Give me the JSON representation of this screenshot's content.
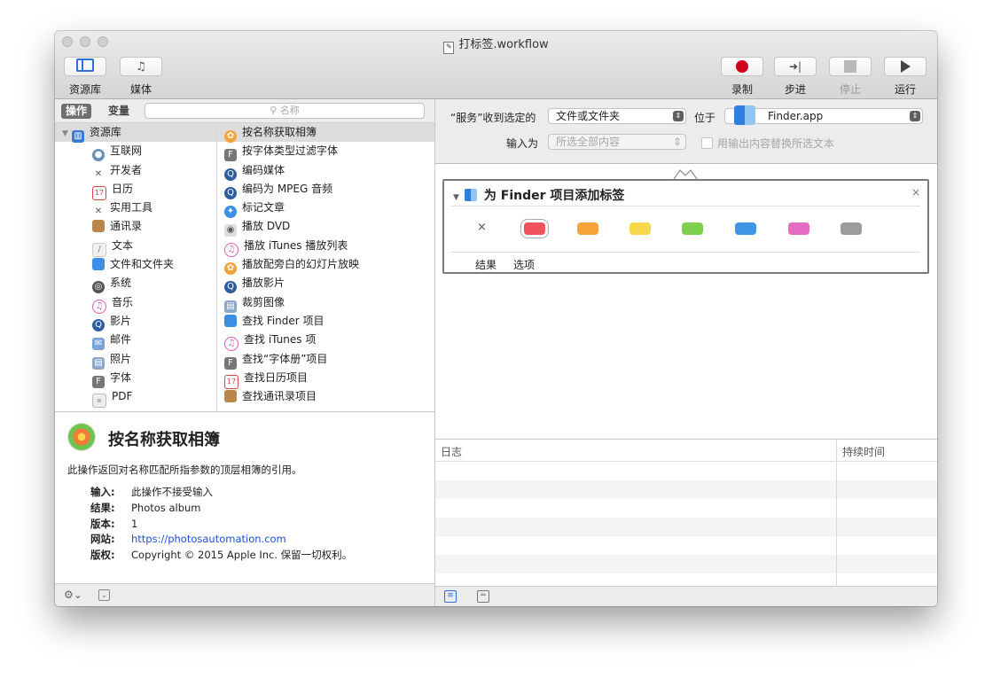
{
  "window": {
    "title": "打标签.workflow"
  },
  "toolbar": {
    "library_label": "资源库",
    "media_label": "媒体",
    "record_label": "录制",
    "step_label": "步进",
    "stop_label": "停止",
    "run_label": "运行"
  },
  "left_tabs": {
    "actions": "操作",
    "variables": "变量"
  },
  "search": {
    "placeholder": "名称"
  },
  "library": {
    "root": "资源库",
    "items": [
      "互联网",
      "开发者",
      "日历",
      "实用工具",
      "通讯录",
      "文本",
      "文件和文件夹",
      "系统",
      "音乐",
      "影片",
      "邮件",
      "照片",
      "字体",
      "PDF"
    ]
  },
  "actions_list": [
    "按名称获取相簿",
    "按字体类型过滤字体",
    "编码媒体",
    "编码为 MPEG 音频",
    "标记文章",
    "播放 DVD",
    "播放 iTunes 播放列表",
    "播放配旁白的幻灯片放映",
    "播放影片",
    "裁剪图像",
    "查找 Finder 项目",
    "查找 iTunes 项",
    "查找“字体册”项目",
    "查找日历项目",
    "查找通讯录项目"
  ],
  "description": {
    "title": "按名称获取相簿",
    "text": "此操作返回对名称匹配所指参数的顶层相簿的引用。",
    "meta": [
      {
        "key": "输入:",
        "value": "此操作不接受输入"
      },
      {
        "key": "结果:",
        "value": "Photos album"
      },
      {
        "key": "版本:",
        "value": "1"
      },
      {
        "key": "网站:",
        "value": "https://photosautomation.com"
      },
      {
        "key": "版权:",
        "value": "Copyright © 2015 Apple Inc. 保留一切权利。"
      }
    ]
  },
  "service": {
    "receives_label": "“服务”收到选定的",
    "receives_value": "文件或文件夹",
    "in_label": "位于",
    "in_value": "Finder.app",
    "input_label": "输入为",
    "input_value": "所选全部内容",
    "replace_label": "用输出内容替换所选文本"
  },
  "action_card": {
    "title": "为 Finder 项目添加标签",
    "clear": "×",
    "tags": [
      "#f0535b",
      "#f6a33a",
      "#f6d84a",
      "#7ed04e",
      "#3e95e6",
      "#e76dc4",
      "#9c9c9c"
    ],
    "tab_results": "结果",
    "tab_options": "选项",
    "close": "×"
  },
  "log": {
    "col_log": "日志",
    "col_duration": "持续时间"
  }
}
